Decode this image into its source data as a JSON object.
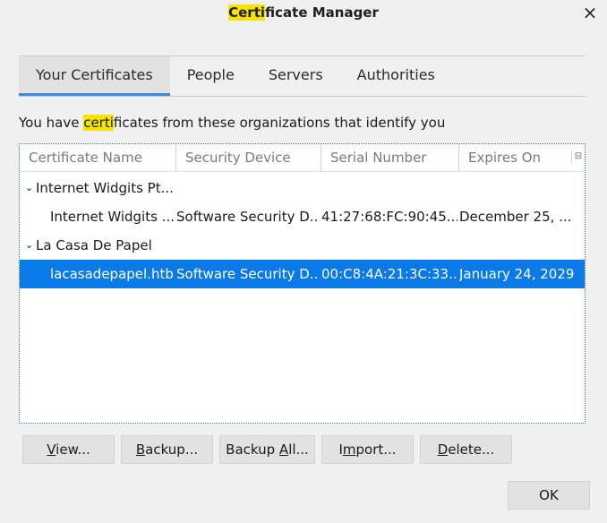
{
  "window": {
    "title_highlight": "Certi",
    "title_rest": "ficate Manager",
    "close_label": "×"
  },
  "tabs": [
    {
      "label": "Your Certificates",
      "active": true
    },
    {
      "label": "People"
    },
    {
      "label": "Servers"
    },
    {
      "label": "Authorities"
    }
  ],
  "intro": {
    "prefix": "You have ",
    "highlight": "certi",
    "suffix": "ficates from these organizations that identify you"
  },
  "table": {
    "columns": [
      "Certificate Name",
      "Security Device",
      "Serial Number",
      "Expires On"
    ],
    "groups": [
      {
        "name": "Internet Widgits Pt...",
        "twisty": "⌄",
        "items": [
          {
            "name": "Internet Widgits ...",
            "device": "Software Security D...",
            "serial": "41:27:68:FC:90:45...",
            "expires": "December 25, ..."
          }
        ]
      },
      {
        "name": "La Casa De Papel",
        "twisty": "⌄",
        "items": [
          {
            "name": "lacasadepapel.htb",
            "device": "Software Security D...",
            "serial": "00:C8:4A:21:3C:33...",
            "expires": "January 24, 2029",
            "selected": true
          }
        ]
      }
    ]
  },
  "buttons": {
    "view": {
      "ul": "V",
      "rest": "iew..."
    },
    "backup": {
      "ul": "B",
      "rest": "ackup..."
    },
    "backup_all": {
      "pre": "Backup ",
      "ul": "A",
      "rest": "ll..."
    },
    "import": {
      "pre": "I",
      "ul": "m",
      "rest": "port..."
    },
    "delete": {
      "ul": "D",
      "rest": "elete..."
    },
    "ok": "OK"
  },
  "colors": {
    "selection": "#0a7ae8",
    "highlight": "#f5e400",
    "tab_accent": "#3a8dde"
  }
}
